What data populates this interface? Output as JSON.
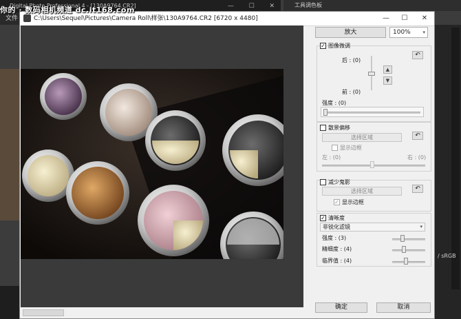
{
  "background_app": {
    "title": "Digital Photo Professional 4 - [130A9764.CR2]",
    "menu_label": "文件",
    "right_panel_title": "工具调色板",
    "color_space": "/ sRGB",
    "window_buttons": {
      "minimize": "—",
      "restore": "☐",
      "close": "✕"
    }
  },
  "watermark": "你的 · 数码相机频道 dc.it168.com",
  "dialog": {
    "title": "C:\\Users\\Sequel\\Pictures\\Camera Roll\\样张\\130A9764.CR2 [6720 x 4480]",
    "window_buttons": {
      "minimize": "—",
      "maximize": "☐",
      "close": "✕"
    }
  },
  "toolbar": {
    "zoom_button": "放大",
    "zoom_value": "100%"
  },
  "fine_tune": {
    "label": "图像微调",
    "checked": true,
    "back_label": "后 : (0)",
    "front_label": "前 : (0)",
    "strength_label": "强度 : (0)",
    "strength_value": 0
  },
  "shift": {
    "label": "散景偏移",
    "checked": false,
    "select_area": "选择区域",
    "show_frame": "显示边框",
    "left_label": "左 : (0)",
    "right_label": "右 : (0)"
  },
  "ghosting": {
    "label": "减少鬼影",
    "checked": false,
    "select_area": "选择区域",
    "show_frame": "显示边框",
    "show_frame_checked": true
  },
  "sharpness": {
    "label": "清晰度",
    "checked": true,
    "filter": "非锐化滤镜",
    "strength_label": "强度 : (3)",
    "fineness_label": "精细度 : (4)",
    "threshold_label": "临界值 : (4)",
    "strength": 3,
    "fineness": 4,
    "threshold": 4
  },
  "footer": {
    "ok": "确定",
    "cancel": "取消"
  },
  "icons": {
    "undo": "undo-icon",
    "up": "arrow-up-icon",
    "down": "arrow-down-icon",
    "check": "✓",
    "dropdown": "▾"
  },
  "colors": {
    "dialog_bg": "#f0f0f0",
    "app_bg": "#3c3c3c",
    "preview_bg": "#3a3a3a"
  }
}
